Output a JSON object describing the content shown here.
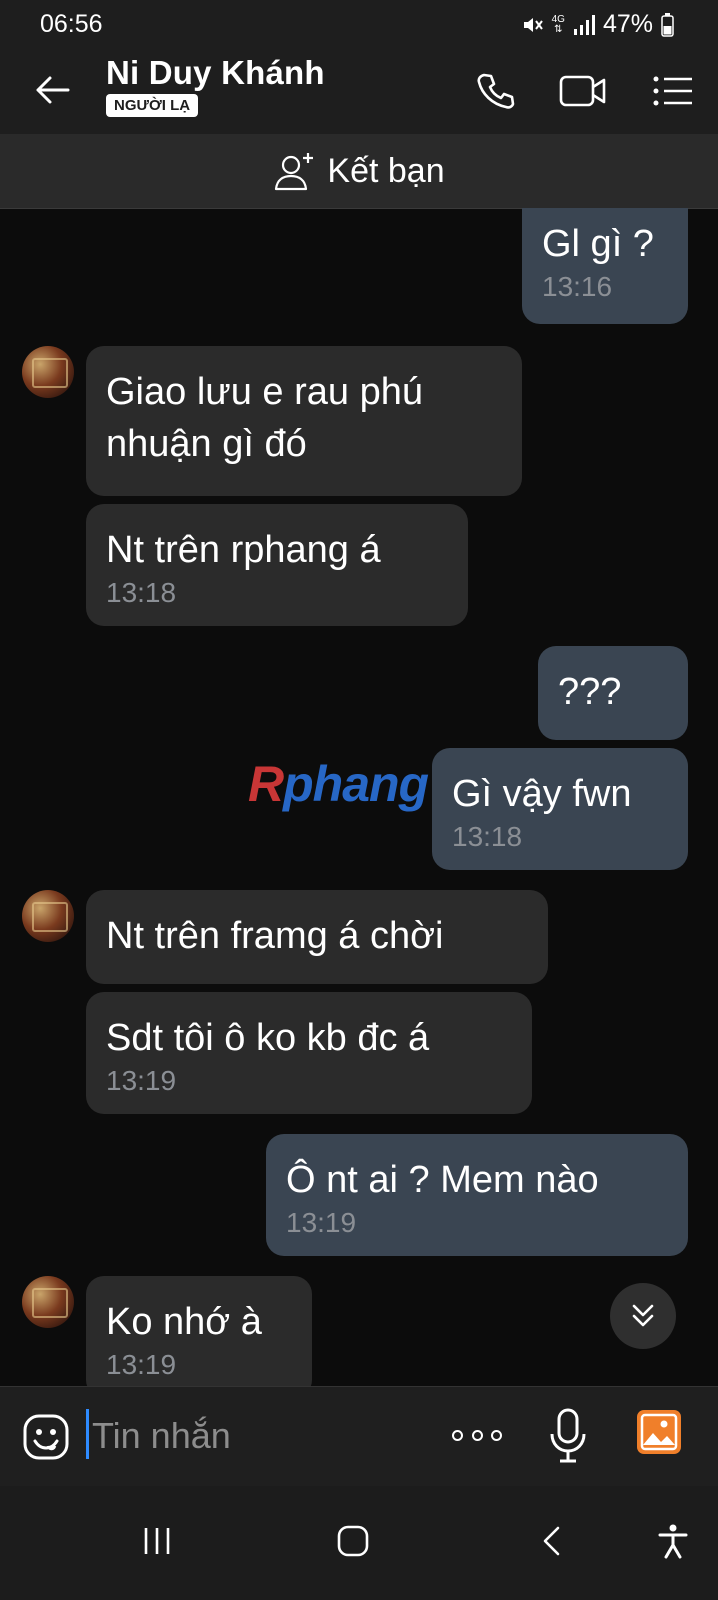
{
  "status_bar": {
    "time": "06:56",
    "network_label": "4G",
    "battery": "47%"
  },
  "header": {
    "contact_name": "Ni Duy Khánh",
    "badge": "NGƯỜI LẠ",
    "icons": [
      "back-arrow-icon",
      "phone-icon",
      "video-icon",
      "menu-list-icon"
    ]
  },
  "add_friend": {
    "label": "Kết bạn",
    "icon": "add-user-icon"
  },
  "messages": [
    {
      "direction": "out",
      "text": "Gl gì ?",
      "time": "13:16"
    },
    {
      "direction": "in",
      "text_lines": [
        "Giao lưu e rau phú",
        "nhuận gì đó"
      ],
      "time": ""
    },
    {
      "direction": "in",
      "text": "Nt trên rphang á",
      "time": "13:18"
    },
    {
      "direction": "out",
      "text": "???",
      "time": ""
    },
    {
      "direction": "out",
      "text": "Gì vậy fwn",
      "time": "13:18"
    },
    {
      "direction": "in",
      "text": "Nt trên framg á chời",
      "time": ""
    },
    {
      "direction": "in",
      "text": "Sdt tôi ô ko kb đc á",
      "time": "13:19"
    },
    {
      "direction": "out",
      "text": "Ô nt ai ? Mem nào",
      "time": "13:19"
    },
    {
      "direction": "in",
      "text": "Ko nhớ à",
      "time": "13:19"
    }
  ],
  "watermark": {
    "prefix": "R",
    "rest": "phang"
  },
  "composer": {
    "placeholder": "Tin nhắn",
    "icons": [
      "emoji-icon",
      "more-icon",
      "mic-icon",
      "gallery-icon"
    ]
  },
  "colors": {
    "background": "#0c0c0c",
    "incoming_bubble": "#2b2b2b",
    "outgoing_bubble": "#3a4552",
    "header": "#1e1e1e",
    "accent": "#2e8bff",
    "gallery": "#f07f2a"
  }
}
